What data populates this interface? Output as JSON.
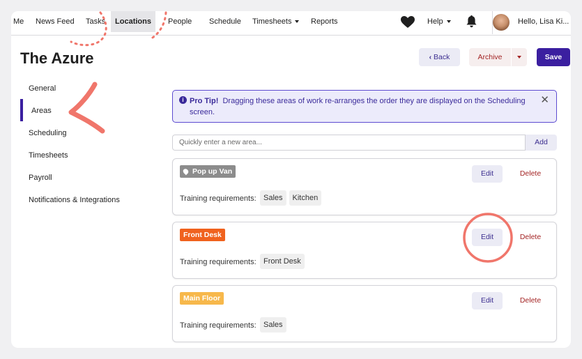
{
  "nav": {
    "items": [
      "Me",
      "News Feed",
      "Tasks",
      "Locations",
      "People",
      "Schedule",
      "Timesheets",
      "Reports"
    ],
    "active": "Locations",
    "help_label": "Help",
    "greeting": "Hello, Lisa Ki..."
  },
  "page": {
    "title": "The Azure",
    "back_label": "Back",
    "archive_label": "Archive",
    "save_label": "Save"
  },
  "sidebar": {
    "items": [
      "General",
      "Areas",
      "Scheduling",
      "Timesheets",
      "Payroll",
      "Notifications & Integrations"
    ],
    "active": "Areas"
  },
  "tip": {
    "title": "Pro Tip!",
    "text": "Dragging these areas of work re-arranges the order they are displayed on the Scheduling screen."
  },
  "add_area": {
    "placeholder": "Quickly enter a new area...",
    "button_label": "Add"
  },
  "areas": [
    {
      "name": "Pop up Van",
      "color": "#8c8c8c",
      "edit_label": "Edit",
      "delete_label": "Delete",
      "requirements_label": "Training requirements:",
      "requirements": [
        "Sales",
        "Kitchen"
      ]
    },
    {
      "name": "Front Desk",
      "color": "#f0621e",
      "edit_label": "Edit",
      "delete_label": "Delete",
      "requirements_label": "Training requirements:",
      "requirements": [
        "Front Desk"
      ]
    },
    {
      "name": "Main Floor",
      "color": "#f7b84b",
      "edit_label": "Edit",
      "delete_label": "Delete",
      "requirements_label": "Training requirements:",
      "requirements": [
        "Sales"
      ]
    }
  ],
  "colors": {
    "accent": "#3b1fa0",
    "danger": "#a32424",
    "annotation": "#f0766b"
  },
  "icons": [
    "heart-icon",
    "bell-icon",
    "info-icon",
    "close-icon",
    "chevron-left-icon",
    "chevron-down-icon",
    "pin-icon"
  ]
}
